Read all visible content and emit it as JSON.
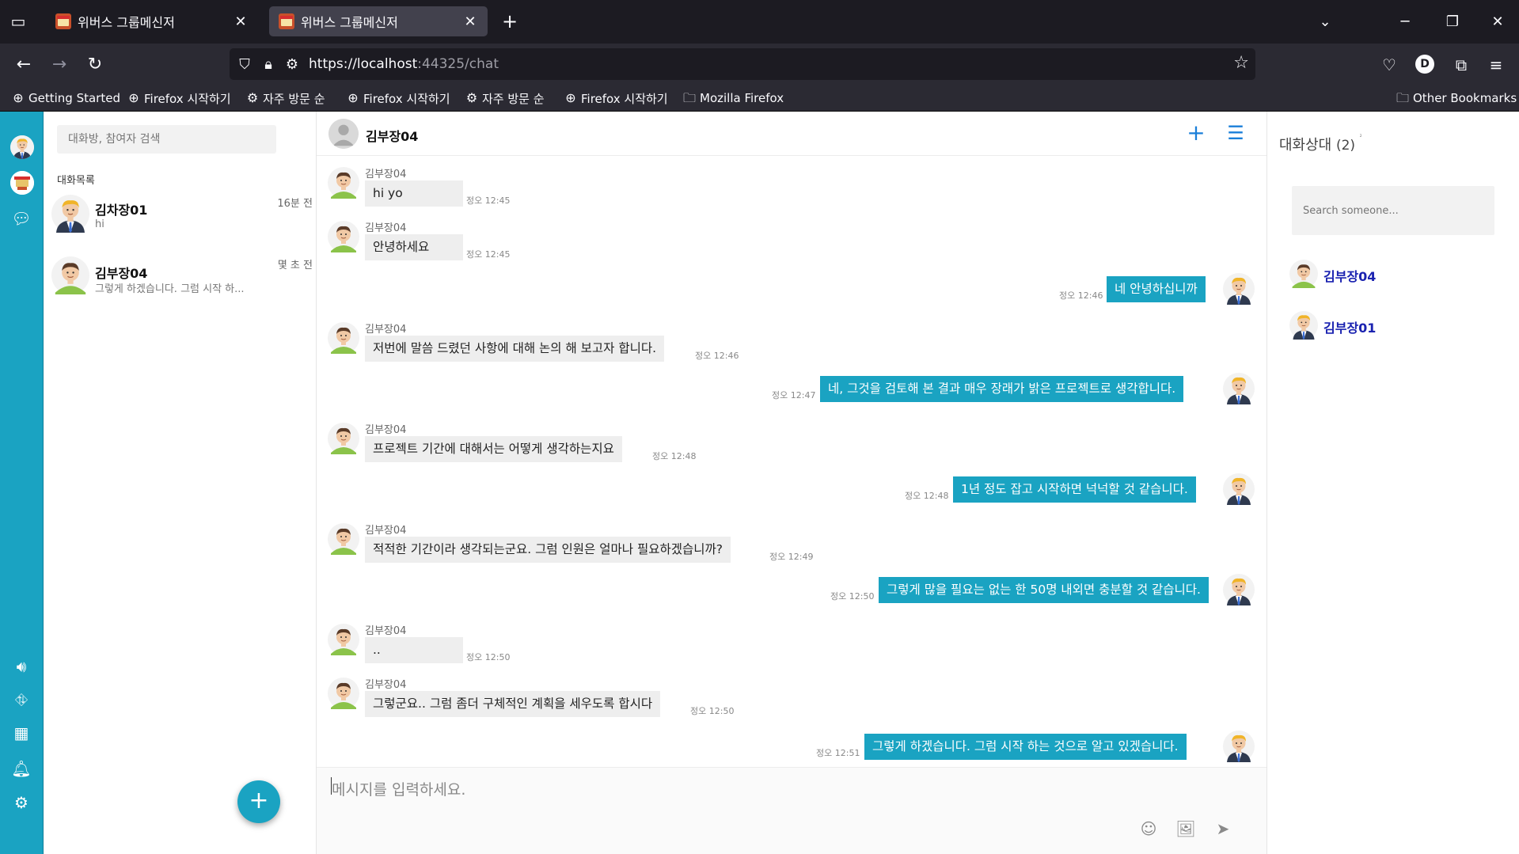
{
  "browser": {
    "tabs": [
      {
        "title": "위버스 그룹메신저",
        "active": false
      },
      {
        "title": "위버스 그룹메신저",
        "active": true
      }
    ],
    "url_host": "https://localhost",
    "url_rest": ":44325/chat",
    "bookmarks": [
      {
        "label": "Getting Started",
        "icon": "globe-icon"
      },
      {
        "label": "Firefox 시작하기",
        "icon": "globe-icon"
      },
      {
        "label": "자주 방문 순",
        "icon": "gear-icon"
      },
      {
        "label": "Firefox 시작하기",
        "icon": "globe-icon"
      },
      {
        "label": "자주 방문 순",
        "icon": "gear-icon"
      },
      {
        "label": "Firefox 시작하기",
        "icon": "globe-icon"
      },
      {
        "label": "Mozilla Firefox",
        "icon": "folder-icon"
      }
    ],
    "other_bookmarks": "Other Bookmarks",
    "profile_initial": "D"
  },
  "sidebar_icons": [
    "avatar",
    "logo",
    "chat-bubble-icon",
    "speaker-icon",
    "org-chart-icon",
    "grid-icon",
    "bell-icon",
    "settings-icon"
  ],
  "conversations": {
    "search_placeholder": "대화방, 참여자 검색",
    "section_title": "대화목록",
    "items": [
      {
        "name": "김차장01",
        "preview": "hi",
        "time": "16분 전"
      },
      {
        "name": "김부장04",
        "preview": "그렇게 하겠습니다. 그럼 시작 하...",
        "time": "몇 초 전"
      }
    ],
    "fab_label": "+"
  },
  "chat": {
    "title": "김부장04",
    "messages": [
      {
        "dir": "in",
        "sender": "김부장04",
        "text": "hi yo",
        "time": "정오 12:45"
      },
      {
        "dir": "in",
        "sender": "김부장04",
        "text": "안녕하세요",
        "time": "정오 12:45"
      },
      {
        "dir": "out",
        "text": "네 안녕하십니까",
        "time": "정오 12:46"
      },
      {
        "dir": "in",
        "sender": "김부장04",
        "text": "저번에 말씀 드렸던 사항에 대해 논의 해 보고자 합니다.",
        "time": "정오 12:46"
      },
      {
        "dir": "out",
        "text": "네, 그것을 검토해 본 결과 매우 장래가 밝은 프로젝트로 생각합니다.",
        "time": "정오 12:47"
      },
      {
        "dir": "in",
        "sender": "김부장04",
        "text": "프로젝트 기간에 대해서는 어떻게 생각하는지요",
        "time": "정오 12:48"
      },
      {
        "dir": "out",
        "text": "1년 정도 잡고 시작하면 넉넉할 것 같습니다.",
        "time": "정오 12:48"
      },
      {
        "dir": "in",
        "sender": "김부장04",
        "text": "적적한 기간이라 생각되는군요. 그럼 인원은 얼마나 필요하겠습니까?",
        "time": "정오 12:49"
      },
      {
        "dir": "out",
        "text": "그렇게 많을 필요는 없는 한 50명 내외면 충분할 것 같습니다.",
        "time": "정오 12:50"
      },
      {
        "dir": "in",
        "sender": "김부장04",
        "text": "..",
        "time": "정오 12:50"
      },
      {
        "dir": "in",
        "sender": "김부장04",
        "text": "그렇군요.. 그럼 좀더 구체적인 계획을 세우도록 합시다",
        "time": "정오 12:50"
      },
      {
        "dir": "out",
        "text": "그렇게 하겠습니다. 그럼 시작 하는 것으로 알고 있겠습니다.",
        "time": "정오 12:51"
      }
    ],
    "composer_placeholder": "메시지를 입력하세요."
  },
  "members": {
    "title": "대화상대",
    "count": "(2)",
    "tiny_note": "2",
    "search_placeholder": "Search someone...",
    "items": [
      {
        "name": "김부장04"
      },
      {
        "name": "김부장01"
      }
    ]
  },
  "colors": {
    "accent": "#1aa3c2",
    "outgoing_bubble": "#1aa3c2",
    "incoming_bubble": "#eeeeee",
    "member_name": "#1a22b0",
    "header_icon": "#1a7fd9"
  }
}
